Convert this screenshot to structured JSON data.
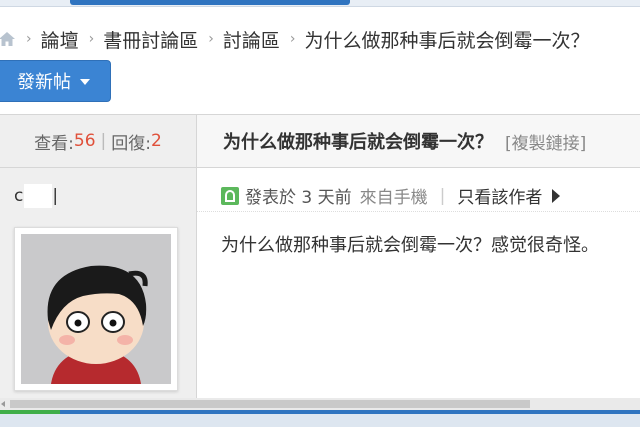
{
  "breadcrumb": {
    "items": [
      "論壇",
      "書冊討論區",
      "討論區",
      "为什么做那种事后就会倒霉一次？"
    ],
    "separator": "›"
  },
  "toolbar": {
    "new_post_label": "發新帖"
  },
  "thread": {
    "views_label": "查看:",
    "views": "56",
    "replies_label": "回復:",
    "replies": "2",
    "title": "为什么做那种事后就会倒霉一次？",
    "copy_link": "[複製鏈接]"
  },
  "post": {
    "author": "c",
    "posted": "發表於 3 天前",
    "source": "來自手機",
    "only_author": "只看該作者",
    "body": "为什么做那种事后就会倒霉一次？感觉很奇怪。"
  },
  "colors": {
    "accent": "#3b84d3",
    "count": "#e0503a",
    "mobile_icon": "#5cb85c"
  }
}
